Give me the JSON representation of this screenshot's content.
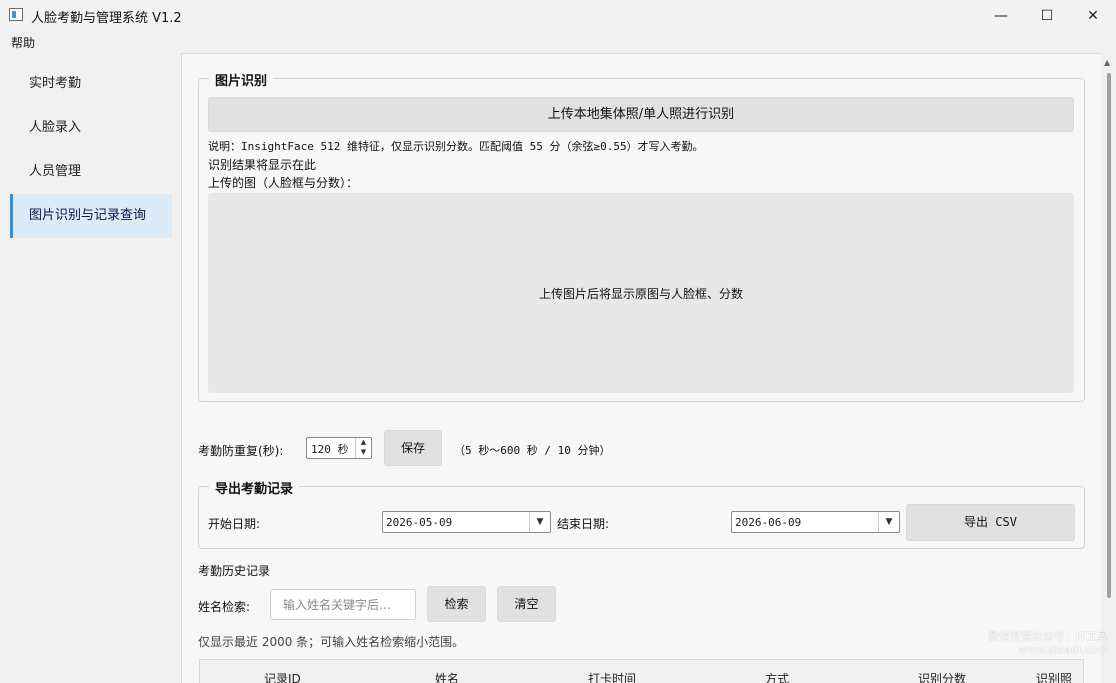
{
  "window": {
    "title": "人脸考勤与管理系统 V1.2",
    "minimize_glyph": "—",
    "maximize_glyph": "☐",
    "close_glyph": "✕"
  },
  "menu": {
    "help": "帮助"
  },
  "sidebar": {
    "items": [
      {
        "label": "实时考勤",
        "active": false
      },
      {
        "label": "人脸录入",
        "active": false
      },
      {
        "label": "人员管理",
        "active": false
      },
      {
        "label": "图片识别与记录查询",
        "active": true
      }
    ]
  },
  "recognition": {
    "group_title": "图片识别",
    "upload_button": "上传本地集体照/单人照进行识别",
    "note": "说明：InsightFace 512 维特征，仅显示识别分数。匹配阈值 55 分（余弦≥0.55）才写入考勤。",
    "result_text": "识别结果将显示在此",
    "uploaded_label": "上传的图（人脸框与分数）：",
    "image_placeholder": "上传图片后将显示原图与人脸框、分数"
  },
  "dedupe": {
    "label": "考勤防重复(秒):",
    "value": "120 秒",
    "save_button": "保存",
    "hint": "（5 秒～600 秒 / 10 分钟）"
  },
  "export": {
    "group_title": "导出考勤记录",
    "start_label": "开始日期:",
    "start_value": "2026-05-09",
    "end_label": "结束日期:",
    "end_value": "2026-06-09",
    "export_button": "导出 CSV"
  },
  "history": {
    "title": "考勤历史记录",
    "name_search_label": "姓名检索:",
    "search_placeholder": "输入姓名关键字后…",
    "search_button": "检索",
    "clear_button": "清空",
    "hint": "仅显示最近 2000 条；可输入姓名检索缩小范围。",
    "columns": [
      "记录ID",
      "姓名",
      "打卡时间",
      "方式",
      "识别分数",
      "识别照"
    ]
  },
  "watermark": {
    "line1": "微信搜索公众号：IT工具",
    "line2": "www.stoadl.com"
  },
  "colors": {
    "accent": "#3b8dd6",
    "active_bg": "#dcebf8"
  }
}
